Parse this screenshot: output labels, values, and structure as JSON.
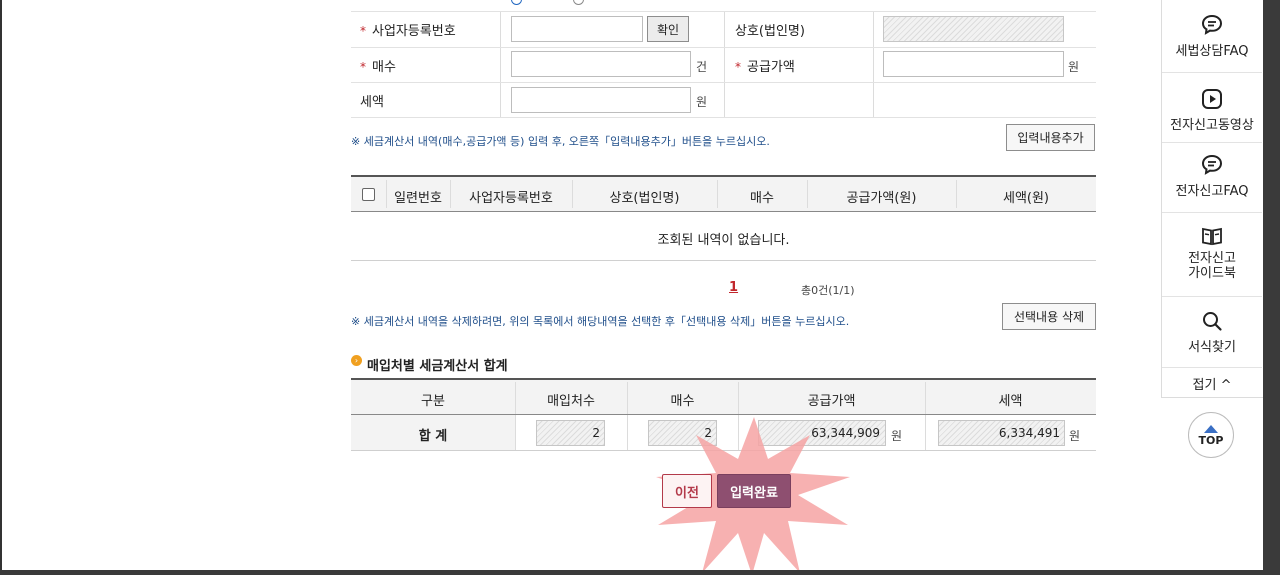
{
  "form": {
    "biz_reg_no_label": "사업자등록번호",
    "confirm_button": "확인",
    "company_label": "상호(법인명)",
    "count_label": "매수",
    "count_unit": "건",
    "supply_label": "공급가액",
    "supply_unit": "원",
    "tax_label": "세액",
    "tax_unit": "원",
    "required_mark": "*"
  },
  "notes": {
    "add_note": "※ 세금계산서 내역(매수,공급가액 등) 입력 후, 오른쪽「입력내용추가」버튼을 누르십시오.",
    "add_button": "입력내용추가",
    "delete_note": "※ 세금계산서 내역을 삭제하려면, 위의 목록에서 해당내역을 선택한 후「선택내용 삭제」버튼을 누르십시오.",
    "delete_button": "선택내용 삭제"
  },
  "list_table": {
    "columns": [
      "일련번호",
      "사업자등록번호",
      "상호(법인명)",
      "매수",
      "공급가액(원)",
      "세액(원)"
    ],
    "empty_message": "조회된 내역이 없습니다."
  },
  "pagination": {
    "current_page": "1",
    "total": "총0건(1/1)"
  },
  "summary": {
    "title": "매입처별 세금계산서 합계",
    "columns": [
      "구분",
      "매입처수",
      "매수",
      "공급가액",
      "세액"
    ],
    "row_label": "합 계",
    "vendor_count": "2",
    "count": "2",
    "supply_amount": "63,344,909",
    "supply_unit": "원",
    "tax_amount": "6,334,491",
    "tax_unit": "원"
  },
  "actions": {
    "prev_button": "이전",
    "complete_button": "입력완료"
  },
  "sidebar": {
    "items": [
      {
        "label": "세법상담FAQ",
        "icon": "chat-bubble-icon"
      },
      {
        "label": "전자신고동영상",
        "icon": "play-icon"
      },
      {
        "label": "전자신고FAQ",
        "icon": "chat-bubble-icon"
      },
      {
        "label": "전자신고\n가이드북",
        "icon": "book-icon"
      },
      {
        "label": "서식찾기",
        "icon": "search-icon"
      }
    ],
    "collapse_label": "접기 ^",
    "top_label": "TOP"
  },
  "colors": {
    "accent_red": "#c1272d",
    "note_blue": "#1f4e8a",
    "complete_button": "#8e4f70",
    "highlight_burst": "#f6a3a3"
  }
}
